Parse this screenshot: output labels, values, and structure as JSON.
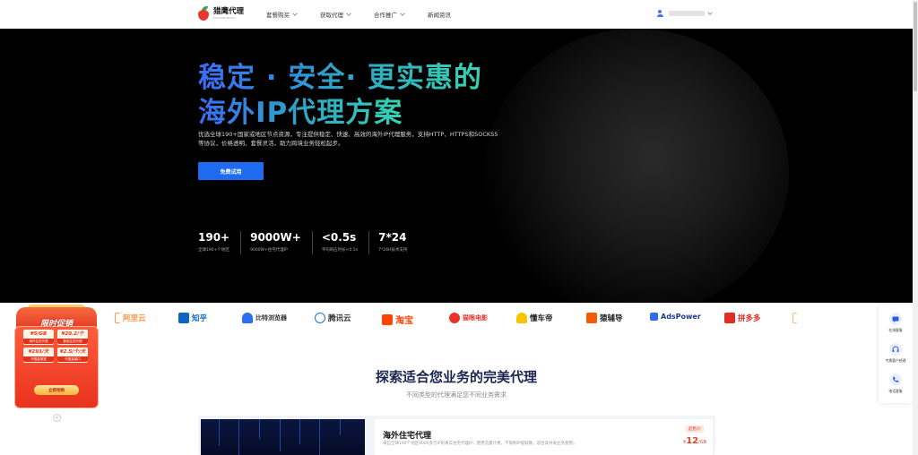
{
  "header": {
    "logo_name": "猎鹰代理",
    "logo_sub": "FALCON PROXY",
    "nav": [
      {
        "label": "套餐购买",
        "has_dropdown": true
      },
      {
        "label": "获取代理",
        "has_dropdown": true
      },
      {
        "label": "合作推广",
        "has_dropdown": true
      },
      {
        "label": "新闻资讯",
        "has_dropdown": false
      }
    ],
    "user_icon": "user-icon"
  },
  "hero": {
    "title_line1": "稳定 · 安全· 更实惠的",
    "title_line2": "海外IP代理方案",
    "description": "优选全球190+国家或地区节点资源，专注提供稳定、快速、高效的海外IP代理服务，支持HTTP、HTTPS和SOCKS5等协议，价格透明、套餐灵活，助力跨境业务轻松起步。",
    "cta_label": "免费试用",
    "stats": [
      {
        "value": "190+",
        "label": "全球190+个地区"
      },
      {
        "value": "9000W+",
        "label": "9000W+住宅代理IP"
      },
      {
        "value": "<0.5s",
        "label": "平均响应时长<0.5s"
      },
      {
        "value": "7*24",
        "label": "7*24H技术支持"
      }
    ],
    "colors": {
      "gradient_start": "#3b6cf6",
      "gradient_end": "#35d4b0",
      "cta": "#1f6bf0"
    }
  },
  "partners": [
    {
      "name": "阿里云",
      "color": "#ff6a00"
    },
    {
      "name": "知乎",
      "color": "#0a66c2"
    },
    {
      "name": "比特浏览器",
      "color": "#2f6df0"
    },
    {
      "name": "腾讯云",
      "color": "#1a72e8"
    },
    {
      "name": "淘宝",
      "color": "#ff4400"
    },
    {
      "name": "猫眼电影",
      "color": "#e8322c"
    },
    {
      "name": "懂车帝",
      "color": "#222222"
    },
    {
      "name": "猿辅导",
      "color": "#222222"
    },
    {
      "name": "AdsPower",
      "color": "#1d3a8a"
    },
    {
      "name": "拼多多",
      "color": "#e02e24"
    }
  ],
  "section": {
    "title": "探索适合您业务的完美代理",
    "subtitle": "不同类型的代理满足您不同业务需求"
  },
  "product_card": {
    "title": "海外住宅代理",
    "description": "来自全球190个地区9000多万IP的真实住宅代理IP，使用流量计费，不限制IP提取数，适合高并发业务使用。",
    "badge": "起售价",
    "price_symbol": "¥",
    "price_value": "12",
    "price_unit": "/GB"
  },
  "promo": {
    "title": "限时促销",
    "items": [
      {
        "price": "¥5/GB",
        "label": "海外住宅代理"
      },
      {
        "price": "¥20.2/个",
        "label": "静态住宅代理"
      },
      {
        "price": "¥293/天",
        "label": "不限量带宽"
      },
      {
        "price": "¥2.5/个/天",
        "label": "不限量端口"
      }
    ],
    "button": "立即抢购",
    "close": "×"
  },
  "float_bar": [
    {
      "label": "在线客服",
      "icon": "chat-icon"
    },
    {
      "label": "专属客户经理",
      "icon": "headset-icon"
    },
    {
      "label": "电话客服",
      "icon": "phone-icon"
    }
  ]
}
